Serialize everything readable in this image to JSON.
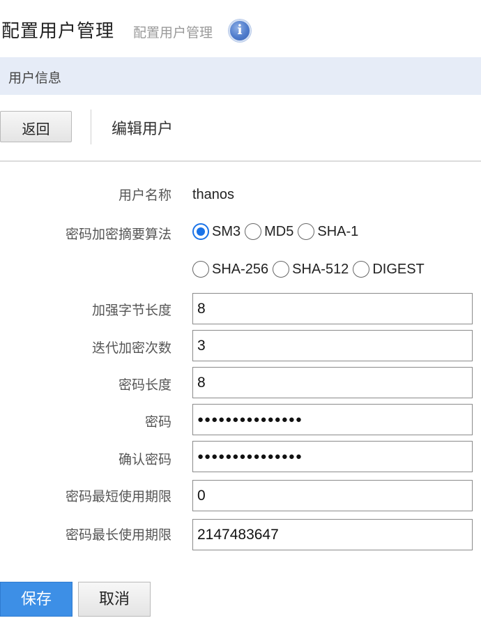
{
  "header": {
    "title": "配置用户管理",
    "subtitle": "配置用户管理",
    "info_icon": "info-icon"
  },
  "section": {
    "title": "用户信息"
  },
  "toolbar": {
    "back_label": "返回",
    "edit_title": "编辑用户"
  },
  "form": {
    "username_label": "用户名称",
    "username_value": "thanos",
    "algo_label": "密码加密摘要算法",
    "algorithms": [
      {
        "label": "SM3",
        "checked": true
      },
      {
        "label": "MD5",
        "checked": false
      },
      {
        "label": "SHA-1",
        "checked": false
      },
      {
        "label": "SHA-256",
        "checked": false
      },
      {
        "label": "SHA-512",
        "checked": false
      },
      {
        "label": "DIGEST",
        "checked": false
      }
    ],
    "salt_label": "加强字节长度",
    "salt_value": "8",
    "iter_label": "迭代加密次数",
    "iter_value": "3",
    "pwlen_label": "密码长度",
    "pwlen_value": "8",
    "password_label": "密码",
    "password_value": "●●●●●●●●●●●●●●●",
    "confirm_label": "确认密码",
    "confirm_value": "●●●●●●●●●●●●●●●",
    "min_age_label": "密码最短使用期限",
    "min_age_value": "0",
    "max_age_label": "密码最长使用期限",
    "max_age_value": "2147483647"
  },
  "actions": {
    "save_label": "保存",
    "cancel_label": "取消"
  },
  "colors": {
    "accent": "#3d8fe6",
    "section_bar": "#e6ecf7",
    "radio_checked": "#1a73e8"
  }
}
